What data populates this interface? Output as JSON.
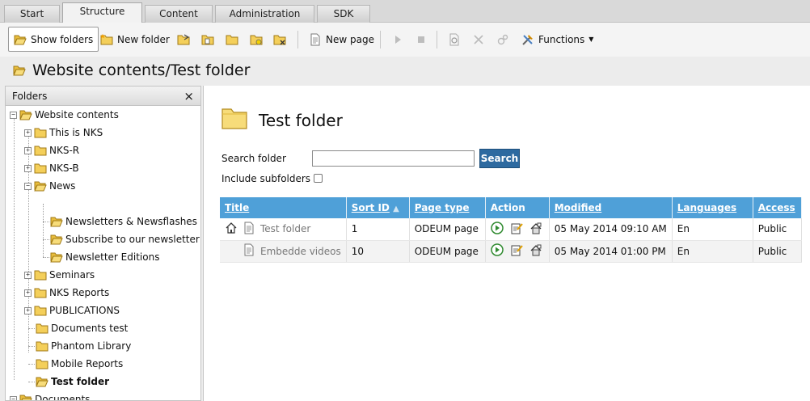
{
  "tabs": [
    "Start",
    "Structure",
    "Content",
    "Administration",
    "SDK"
  ],
  "toolbar": {
    "show_folders": "Show folders",
    "new_folder": "New folder",
    "new_page": "New page",
    "functions": "Functions"
  },
  "page_title": "Website contents/Test folder",
  "folders_panel": {
    "title": "Folders",
    "close": "×",
    "tree": [
      "Website contents",
      "This is NKS",
      "NKS-R",
      "NKS-B",
      "News",
      "Newsletters & Newsflashes",
      "Subscribe to our newsletter",
      "Newsletter Editions",
      "Seminars",
      "NKS Reports",
      "PUBLICATIONS",
      "Documents test",
      "Phantom Library",
      "Mobile Reports",
      "Test folder",
      "Documents"
    ]
  },
  "main": {
    "title": "Test folder",
    "search_label": "Search folder",
    "search_value": "",
    "search_button": "Search",
    "include_sub": "Include subfolders",
    "include_sub_checked": false,
    "columns": [
      "Title",
      "Sort ID",
      "Page type",
      "Action",
      "Modified",
      "Languages",
      "Access"
    ],
    "sort_indicator": "▲",
    "rows": [
      {
        "title": "Test folder",
        "sort": "1",
        "type": "ODEUM page",
        "modified": "05 May 2014 09:10 AM",
        "lang": "En",
        "access": "Public"
      },
      {
        "title": "Embedde videos",
        "sort": "10",
        "type": "ODEUM page",
        "modified": "05 May 2014 01:00 PM",
        "lang": "En",
        "access": "Public"
      }
    ]
  },
  "colors": {
    "header_blue": "#4fa0d8",
    "button_blue": "#2d6aa0",
    "folder_yellow": "#f4cf5a"
  }
}
